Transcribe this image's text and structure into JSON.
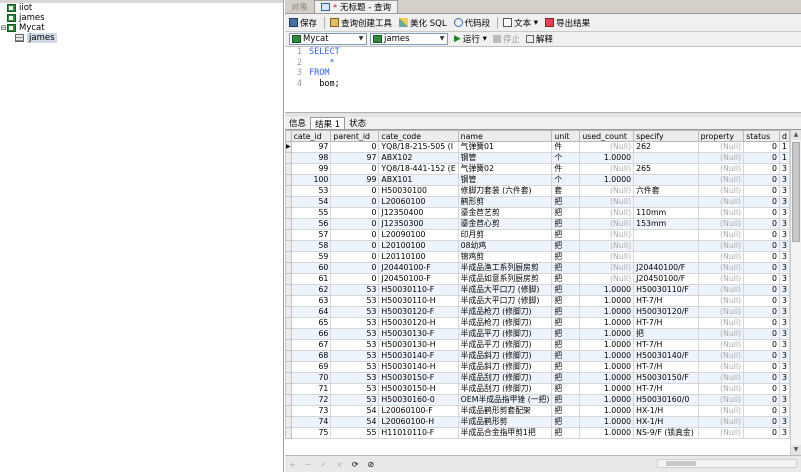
{
  "navigator": {
    "items": [
      {
        "label": "iiot",
        "expander": "",
        "icon": "db",
        "selected": false
      },
      {
        "label": "james",
        "expander": "",
        "icon": "db",
        "selected": false
      },
      {
        "label": "Mycat",
        "expander": "⊟",
        "icon": "db",
        "selected": false
      },
      {
        "label": "james",
        "expander": "",
        "icon": "table",
        "selected": true
      }
    ]
  },
  "editor": {
    "tabs": [
      {
        "label": "对象",
        "active": false
      },
      {
        "label": "无标题 - 查询",
        "active": true,
        "modified_mark": "*"
      }
    ],
    "toolbar": {
      "save": "保存",
      "query_builder": "查询创建工具",
      "beautify": "美化 SQL",
      "snippet": "代码段",
      "text": "文本",
      "export": "导出结果"
    },
    "connection": "Mycat",
    "database": "james",
    "run": "运行",
    "stop": "停止",
    "explain": "解释",
    "sql_lines": [
      {
        "n": "1",
        "text": "SELECT",
        "kind": "kw"
      },
      {
        "n": "2",
        "text": "    *",
        "kind": "kw"
      },
      {
        "n": "3",
        "text": "FROM",
        "kind": "kw"
      },
      {
        "n": "4",
        "text": "  bom;",
        "kind": "cd"
      }
    ],
    "result_tabs": [
      "信息",
      "结果 1",
      "状态"
    ],
    "active_result_tab": 1
  },
  "grid": {
    "columns": [
      "cate_id",
      "parent_id",
      "cate_code",
      "name",
      "unit",
      "used_count",
      "specify",
      "property",
      "status",
      "d"
    ],
    "rows": [
      [
        "97",
        "0",
        "YQ8/18-215-505 (I",
        "气弹簧01",
        "件",
        "(Null)",
        "262",
        "(Null)",
        "0",
        "1"
      ],
      [
        "98",
        "97",
        "ABX102",
        "钢管",
        "个",
        "1.0000",
        "",
        "(Null)",
        "0",
        "1"
      ],
      [
        "99",
        "0",
        "YQ8/18-441-152 (E",
        "气弹簧02",
        "件",
        "(Null)",
        "265",
        "(Null)",
        "0",
        "3"
      ],
      [
        "100",
        "99",
        "ABX101",
        "钢管",
        "个",
        "1.0000",
        "",
        "(Null)",
        "0",
        "3"
      ],
      [
        "53",
        "0",
        "H50030100",
        "修脚刀套装 (六件套)",
        "套",
        "(Null)",
        "六件套",
        "(Null)",
        "0",
        "3"
      ],
      [
        "54",
        "0",
        "L20060100",
        "鹤形剪",
        "把",
        "(Null)",
        "",
        "(Null)",
        "0",
        "3"
      ],
      [
        "55",
        "0",
        "J12350400",
        "鎏金苣艺剪",
        "把",
        "(Null)",
        "110mm",
        "(Null)",
        "0",
        "3"
      ],
      [
        "56",
        "0",
        "J12350300",
        "鎏金苣心剪",
        "把",
        "(Null)",
        "153mm",
        "(Null)",
        "0",
        "3"
      ],
      [
        "57",
        "0",
        "L20090100",
        "印月剪",
        "把",
        "(Null)",
        "",
        "(Null)",
        "0",
        "3"
      ],
      [
        "58",
        "0",
        "L20100100",
        "08幼鸡",
        "把",
        "(Null)",
        "",
        "(Null)",
        "0",
        "3"
      ],
      [
        "59",
        "0",
        "L20110100",
        "锦鸡剪",
        "把",
        "(Null)",
        "",
        "(Null)",
        "0",
        "3"
      ],
      [
        "60",
        "0",
        "J20440100-F",
        "半成品渔工系列厨房剪",
        "把",
        "(Null)",
        "J20440100/F",
        "(Null)",
        "0",
        "3"
      ],
      [
        "61",
        "0",
        "J20450100-F",
        "半成品如意系列厨房剪",
        "把",
        "(Null)",
        "J20450100/F",
        "(Null)",
        "0",
        "3"
      ],
      [
        "62",
        "53",
        "H50030110-F",
        "半成品大平口刀 (修脚)",
        "把",
        "1.0000",
        "H50030110/F",
        "(Null)",
        "0",
        "3"
      ],
      [
        "63",
        "53",
        "H50030110-H",
        "半成品大平口刀 (修脚)",
        "把",
        "1.0000",
        "HT-7/H",
        "(Null)",
        "0",
        "3"
      ],
      [
        "64",
        "53",
        "H50030120-F",
        "半成品枪刀 (修脚刀)",
        "把",
        "1.0000",
        "H50030120/F",
        "(Null)",
        "0",
        "3"
      ],
      [
        "65",
        "53",
        "H50030120-H",
        "半成品枪刀 (修脚刀)",
        "把",
        "1.0000",
        "HT-7/H",
        "(Null)",
        "0",
        "3"
      ],
      [
        "66",
        "53",
        "H50030130-F",
        "半成品平刀 (修脚刀)",
        "把",
        "1.0000",
        "把",
        "(Null)",
        "0",
        "3"
      ],
      [
        "67",
        "53",
        "H50030130-H",
        "半成品平刀 (修脚刀)",
        "把",
        "1.0000",
        "HT-7/H",
        "(Null)",
        "0",
        "3"
      ],
      [
        "68",
        "53",
        "H50030140-F",
        "半成品斜刀 (修脚刀)",
        "把",
        "1.0000",
        "H50030140/F",
        "(Null)",
        "0",
        "3"
      ],
      [
        "69",
        "53",
        "H50030140-H",
        "半成品斜刀 (修脚刀)",
        "把",
        "1.0000",
        "HT-7/H",
        "(Null)",
        "0",
        "3"
      ],
      [
        "70",
        "53",
        "H50030150-F",
        "半成品刮刀 (修脚刀)",
        "把",
        "1.0000",
        "H50030150/F",
        "(Null)",
        "0",
        "3"
      ],
      [
        "71",
        "53",
        "H50030150-H",
        "半成品刮刀 (修脚刀)",
        "把",
        "1.0000",
        "HT-7/H",
        "(Null)",
        "0",
        "3"
      ],
      [
        "72",
        "53",
        "H50030160-0",
        "OEM半成品指甲锉 (一把)",
        "把",
        "1.0000",
        "H50030160/0",
        "(Null)",
        "0",
        "3"
      ],
      [
        "73",
        "54",
        "L20060100-F",
        "半成品鹤形剪套配架",
        "把",
        "1.0000",
        "HX-1/H",
        "(Null)",
        "0",
        "3"
      ],
      [
        "74",
        "54",
        "L20060100-H",
        "半成品鹤形剪",
        "把",
        "1.0000",
        "HX-1/H",
        "(Null)",
        "0",
        "3"
      ],
      [
        "75",
        "55",
        "H11010110-F",
        "半成品合金指甲剪1把",
        "把",
        "1.0000",
        "NS-9/F (锁真金)",
        "(Null)",
        "0",
        "3"
      ]
    ],
    "selected_row": 0
  },
  "statusbar": {
    "buttons": [
      "+",
      "−",
      "✓",
      "×",
      "⟳",
      "⊘"
    ]
  }
}
